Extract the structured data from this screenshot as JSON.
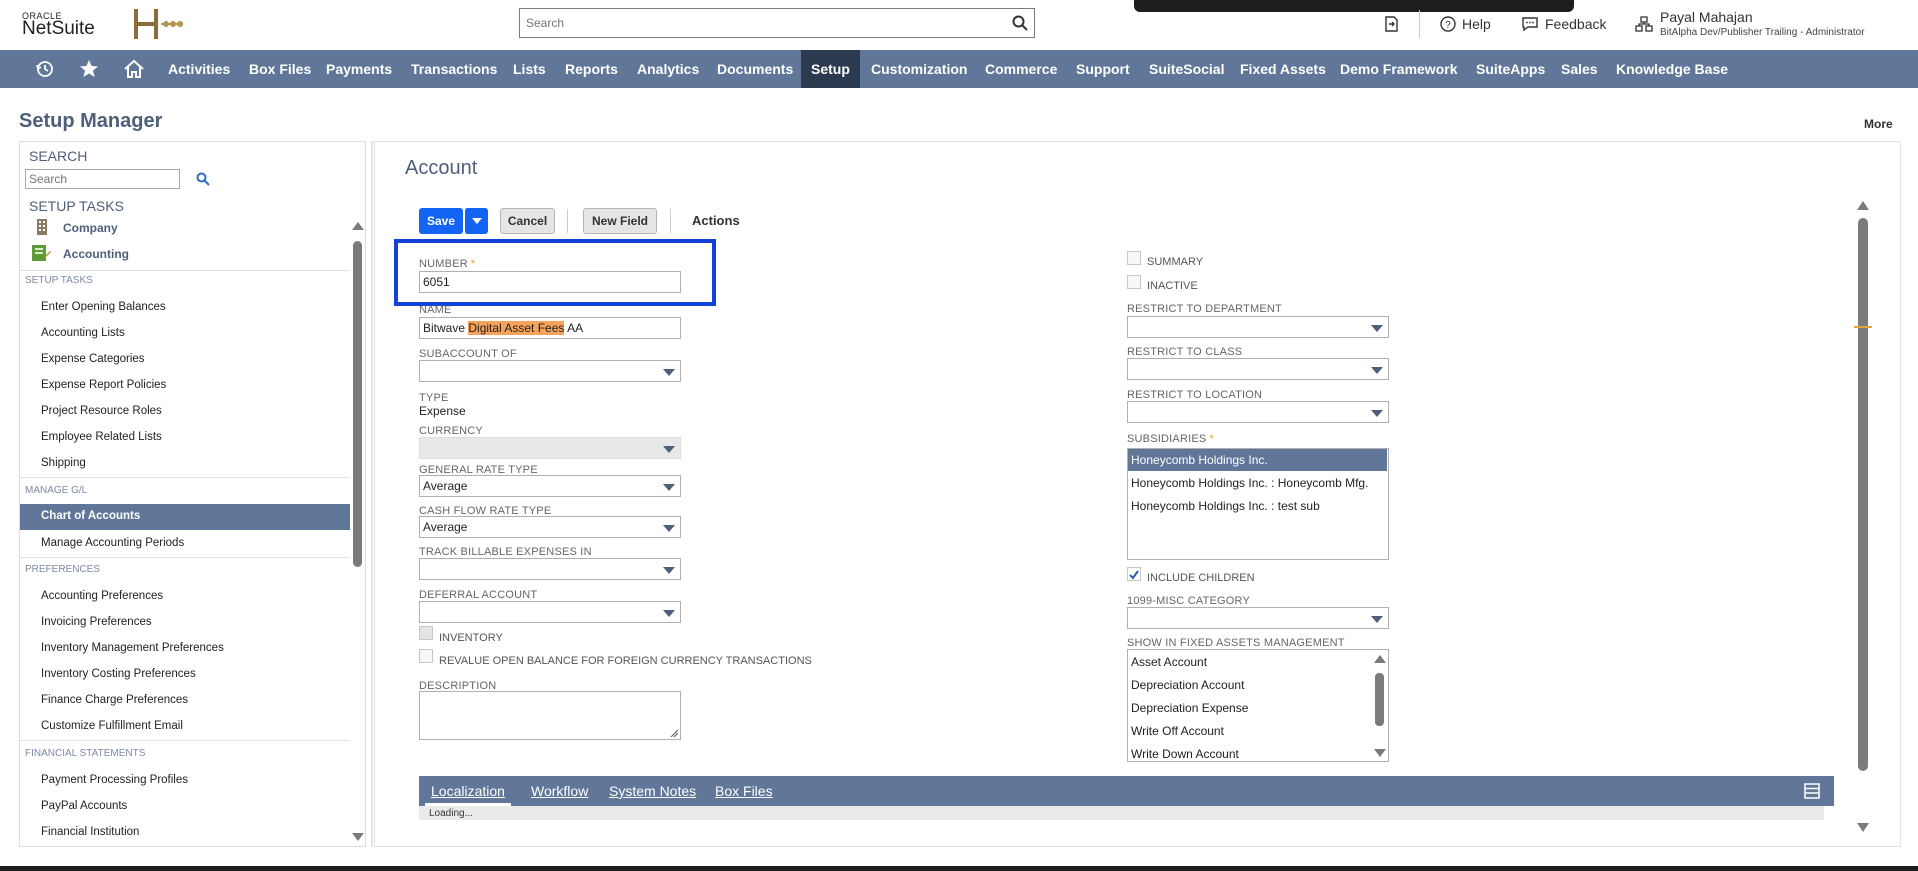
{
  "header": {
    "oracle_label": "ORACLE",
    "netsuite_label": "NetSuite",
    "search_placeholder": "Search",
    "help_label": "Help",
    "feedback_label": "Feedback",
    "user_name": "Payal Mahajan",
    "user_role": "BitAlpha Dev/Publisher Trailing - Administrator"
  },
  "nav": {
    "items": [
      "Activities",
      "Box Files",
      "Payments",
      "Transactions",
      "Lists",
      "Reports",
      "Analytics",
      "Documents",
      "Setup",
      "Customization",
      "Commerce",
      "Support",
      "SuiteSocial",
      "Fixed Assets",
      "Demo Framework",
      "SuiteApps",
      "Sales",
      "Knowledge Base"
    ],
    "active": "Setup"
  },
  "page": {
    "title": "Setup Manager",
    "more_label": "More"
  },
  "sidebar": {
    "search_heading": "SEARCH",
    "search_placeholder": "Search",
    "setup_tasks_heading": "SETUP TASKS",
    "tasks": [
      "Company",
      "Accounting"
    ],
    "sections": [
      {
        "title": "SETUP TASKS",
        "links": [
          "Enter Opening Balances",
          "Accounting Lists",
          "Expense Categories",
          "Expense Report Policies",
          "Project Resource Roles",
          "Employee Related Lists",
          "Shipping"
        ]
      },
      {
        "title": "MANAGE G/L",
        "links": [
          "Chart of Accounts",
          "Manage Accounting Periods"
        ]
      },
      {
        "title": "PREFERENCES",
        "links": [
          "Accounting Preferences",
          "Invoicing Preferences",
          "Inventory Management Preferences",
          "Inventory Costing Preferences",
          "Finance Charge Preferences",
          "Customize Fulfillment Email"
        ]
      },
      {
        "title": "FINANCIAL STATEMENTS",
        "links": [
          "Payment Processing Profiles",
          "PayPal Accounts",
          "Financial Institution"
        ]
      }
    ],
    "active_link": "Chart of Accounts"
  },
  "form": {
    "title": "Account",
    "buttons": {
      "save": "Save",
      "cancel": "Cancel",
      "new_field": "New Field",
      "actions": "Actions"
    },
    "number": {
      "label": "NUMBER",
      "value": "6051"
    },
    "name": {
      "label": "NAME",
      "value_before": "Bitwave ",
      "value_highlight": "Digital Asset Fees",
      "value_after": " AA"
    },
    "subaccount_of": {
      "label": "SUBACCOUNT OF",
      "value": ""
    },
    "type": {
      "label": "TYPE",
      "value": "Expense"
    },
    "currency": {
      "label": "CURRENCY",
      "value": ""
    },
    "general_rate_type": {
      "label": "GENERAL RATE TYPE",
      "value": "Average"
    },
    "cash_flow_rate_type": {
      "label": "CASH FLOW RATE TYPE",
      "value": "Average"
    },
    "track_billable": {
      "label": "TRACK BILLABLE EXPENSES IN",
      "value": ""
    },
    "deferral_account": {
      "label": "DEFERRAL ACCOUNT",
      "value": ""
    },
    "inventory_label": "INVENTORY",
    "revalue_label": "REVALUE OPEN BALANCE FOR FOREIGN CURRENCY TRANSACTIONS",
    "description_label": "DESCRIPTION",
    "summary_label": "SUMMARY",
    "inactive_label": "INACTIVE",
    "restrict_department_label": "RESTRICT TO DEPARTMENT",
    "restrict_class_label": "RESTRICT TO CLASS",
    "restrict_location_label": "RESTRICT TO LOCATION",
    "subsidiaries": {
      "label": "SUBSIDIARIES",
      "options": [
        "Honeycomb Holdings Inc.",
        "Honeycomb Holdings Inc. : Honeycomb Mfg.",
        "Honeycomb Holdings Inc. : test sub"
      ],
      "selected": "Honeycomb Holdings Inc."
    },
    "include_children": {
      "label": "INCLUDE CHILDREN",
      "checked": true
    },
    "misc_1099": {
      "label": "1099-MISC CATEGORY",
      "value": ""
    },
    "fixed_assets": {
      "label": "SHOW IN FIXED ASSETS MANAGEMENT",
      "options": [
        "Asset Account",
        "Depreciation Account",
        "Depreciation Expense",
        "Write Off Account",
        "Write Down Account"
      ]
    }
  },
  "tabs": {
    "items": [
      "Localization",
      "Workflow",
      "System Notes",
      "Box Files"
    ],
    "active": "Localization",
    "loading_text": "Loading..."
  },
  "colors": {
    "nav_bg": "#607799",
    "nav_active": "#2b3a4f",
    "primary_button": "#1464f4",
    "focus_border": "#1342d8",
    "highlight": "#f7a35c"
  }
}
